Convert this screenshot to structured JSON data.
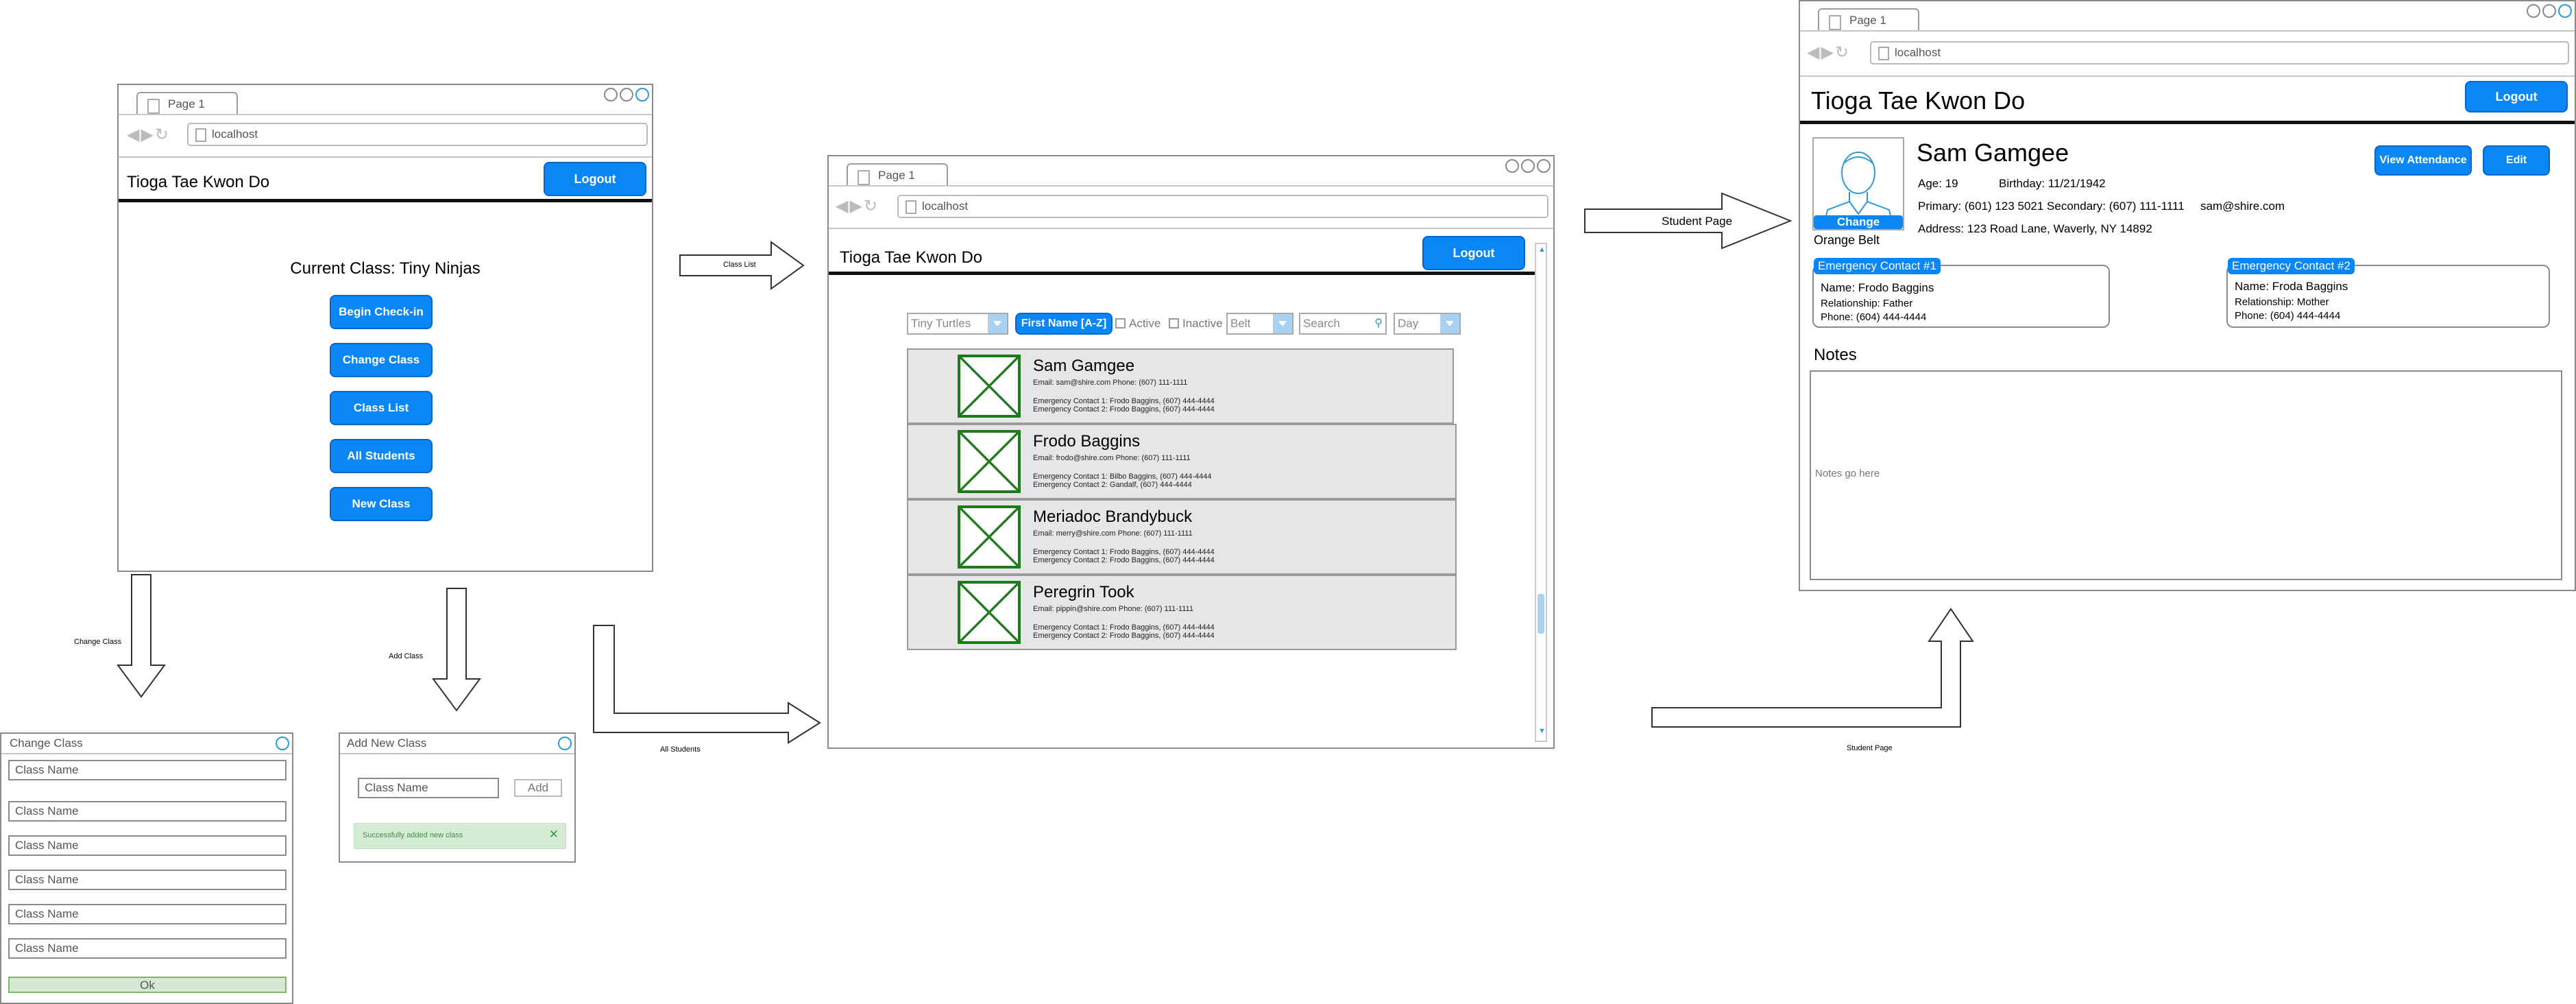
{
  "browser": {
    "tab_label": "Page 1",
    "url": "localhost"
  },
  "app": {
    "title": "Tioga Tae Kwon Do",
    "logout_label": "Logout"
  },
  "home": {
    "current_class": "Current Class: Tiny Ninjas",
    "buttons": [
      "Begin Check-in",
      "Change Class",
      "Class List",
      "All Students",
      "New Class"
    ]
  },
  "arrows": {
    "class_list": "Class List",
    "change_class": "Change Class",
    "add_class": "Add Class",
    "all_students": "All Students",
    "student_page_top": "Student Page",
    "student_page_bottom": "Student Page"
  },
  "change_class_dialog": {
    "title": "Change Class",
    "items": [
      "Class Name",
      "Class Name",
      "Class Name",
      "Class Name",
      "Class Name",
      "Class Name"
    ],
    "ok_label": "Ok"
  },
  "add_class_dialog": {
    "title": "Add New Class",
    "placeholder": "Class Name",
    "add_label": "Add",
    "success": "Successfully added new class",
    "close": "✕"
  },
  "list": {
    "filters": {
      "class": "Tiny Turtles",
      "sort": "First Name [A-Z]",
      "active": "Active",
      "inactive": "Inactive",
      "belt": "Belt",
      "search": "Search",
      "day": "Day"
    },
    "students": [
      {
        "name": "Sam Gamgee",
        "contact": "Email: sam@shire.com Phone: (607) 111-1111",
        "ec1": "Emergency Contact 1: Frodo Baggins, (607) 444-4444",
        "ec2": "Emergency Contact 2: Frodo Baggins, (607) 444-4444"
      },
      {
        "name": "Frodo Baggins",
        "contact": "Email: frodo@shire.com Phone: (607) 111-1111",
        "ec1": "Emergency Contact 1: Bilbo Baggins, (607) 444-4444",
        "ec2": "Emergency Contact 2: Gandalf, (607) 444-4444"
      },
      {
        "name": "Meriadoc Brandybuck",
        "contact": "Email: merry@shire.com Phone: (607) 111-1111",
        "ec1": "Emergency Contact 1: Frodo Baggins, (607) 444-4444",
        "ec2": "Emergency Contact 2: Frodo Baggins, (607) 444-4444"
      },
      {
        "name": "Peregrin Took",
        "contact": "Email: pippin@shire.com Phone: (607) 111-1111",
        "ec1": "Emergency Contact 1: Frodo Baggins, (607) 444-4444",
        "ec2": "Emergency Contact 2: Frodo Baggins, (607) 444-4444"
      }
    ]
  },
  "student": {
    "name": "Sam Gamgee",
    "age": "Age: 19",
    "birthday": "Birthday: 11/21/1942",
    "phones": "Primary: (601) 123 5021 Secondary: (607) 111-1111",
    "email": "sam@shire.com",
    "address": "Address: 123 Road Lane, Waverly, NY 14892",
    "change_label": "Change",
    "belt": "Orange Belt",
    "view_attendance": "View Attendance",
    "edit": "Edit",
    "ec1": {
      "tag": "Emergency Contact #1",
      "name": "Name: Frodo Baggins",
      "relationship": "Relationship: Father",
      "phone": "Phone: (604) 444-4444"
    },
    "ec2": {
      "tag": "Emergency Contact #2",
      "name": "Name: Froda Baggins",
      "relationship": "Relationship: Mother",
      "phone": "Phone: (604) 444-4444"
    },
    "notes_heading": "Notes",
    "notes_placeholder": "Notes go here"
  }
}
